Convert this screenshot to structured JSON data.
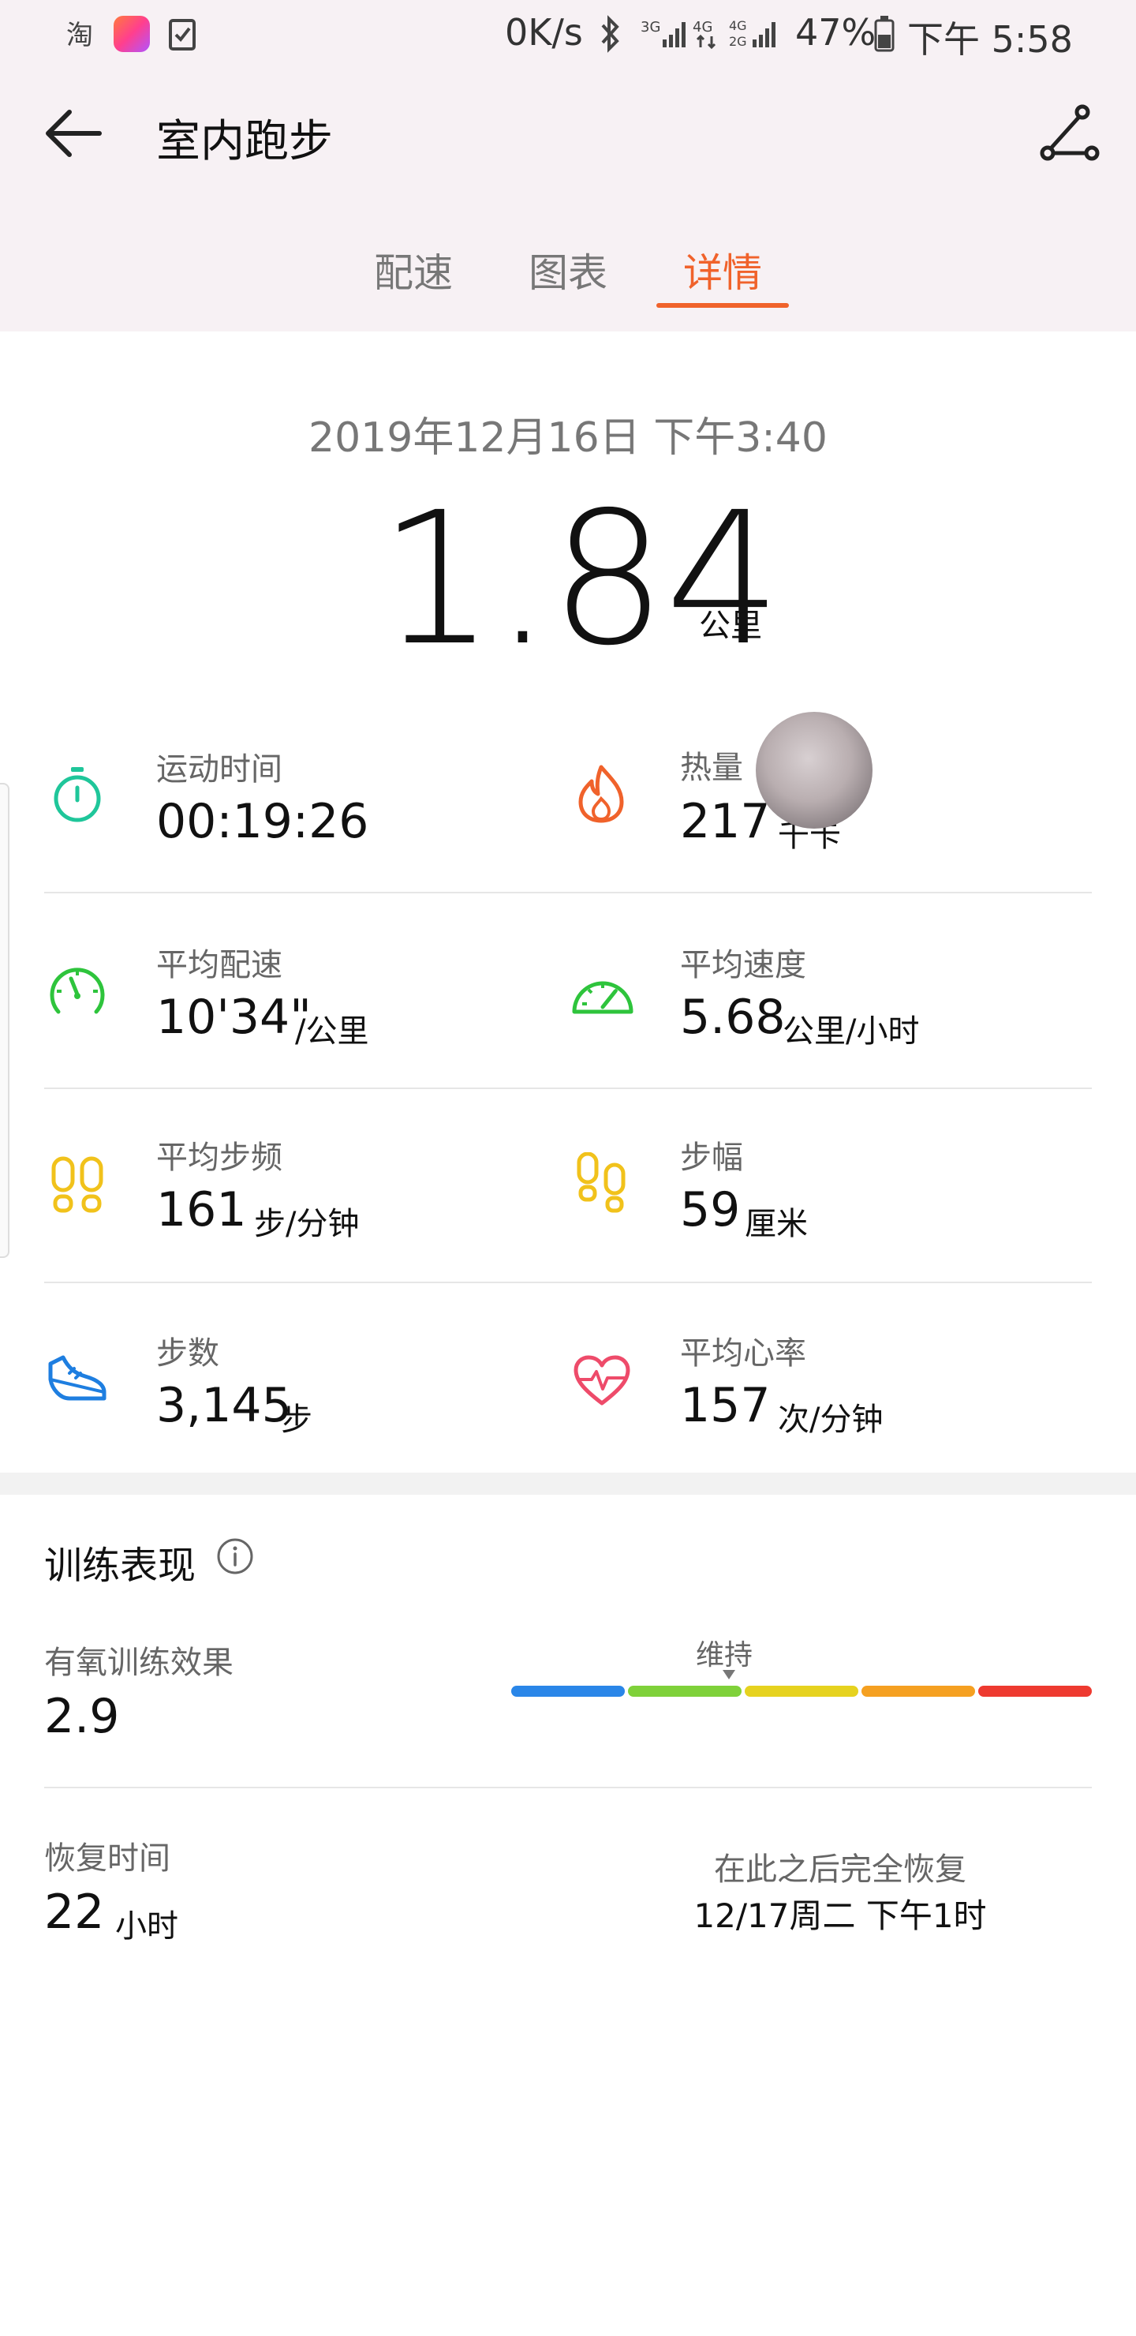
{
  "status_bar": {
    "left_icons": [
      "taobao-icon",
      "app-badge-icon",
      "task-check-icon"
    ],
    "speed": "0K/s",
    "battery": "47%",
    "time": "下午 5:58"
  },
  "header": {
    "title": "室内跑步"
  },
  "tabs": [
    {
      "label": "配速",
      "active": false
    },
    {
      "label": "图表",
      "active": false
    },
    {
      "label": "详情",
      "active": true
    }
  ],
  "summary": {
    "datetime": "2019年12月16日 下午3:40",
    "distance": "1.84",
    "distance_unit": "公里"
  },
  "metrics": [
    {
      "label": "运动时间",
      "value": "00:19:26",
      "unit": "",
      "icon": "stopwatch-icon"
    },
    {
      "label": "热量",
      "value": "217",
      "unit": "千卡",
      "icon": "flame-icon"
    },
    {
      "label": "平均配速",
      "value": "10'34\"",
      "unit": "/公里",
      "icon": "pace-gauge-icon"
    },
    {
      "label": "平均速度",
      "value": "5.68",
      "unit": "公里/小时",
      "icon": "speedometer-icon"
    },
    {
      "label": "平均步频",
      "value": "161",
      "unit": "步/分钟",
      "icon": "footprints-icon"
    },
    {
      "label": "步幅",
      "value": "59",
      "unit": "厘米",
      "icon": "stride-footprints-icon"
    },
    {
      "label": "步数",
      "value": "3,145",
      "unit": "步",
      "icon": "sneaker-icon"
    },
    {
      "label": "平均心率",
      "value": "157",
      "unit": "次/分钟",
      "icon": "heart-rate-icon"
    }
  ],
  "performance": {
    "title": "训练表现",
    "aerobic_label": "有氧训练效果",
    "aerobic_value": "2.9",
    "aerobic_marker_label": "维持",
    "aerobic_marker_fraction": 0.375,
    "scale_colors": [
      "#2a86e8",
      "#7fd13a",
      "#e6d21f",
      "#f5a021",
      "#ee3a30"
    ],
    "recovery_label": "恢复时间",
    "recovery_value": "22",
    "recovery_unit": "小时",
    "full_recovery_label": "在此之后完全恢复",
    "full_recovery_time": "12/17周二 下午1时"
  },
  "colors": {
    "accent": "#f0622b",
    "teal": "#1fc69a",
    "green": "#2ec43c",
    "yellow": "#f1c21b",
    "blue": "#1e7ee0",
    "pink": "#ee4b6a"
  }
}
